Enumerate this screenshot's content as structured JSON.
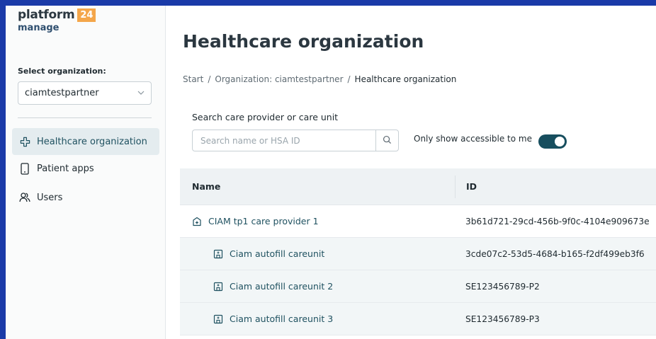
{
  "brand": {
    "name": "platform",
    "badge": "24",
    "sub": "manage"
  },
  "sidebar": {
    "org_label": "Select organization:",
    "org_value": "ciamtestpartner",
    "items": [
      {
        "label": "Healthcare organization",
        "icon": "plus-outline-icon",
        "active": true
      },
      {
        "label": "Patient apps",
        "icon": "phone-icon",
        "active": false
      },
      {
        "label": "Users",
        "icon": "users-icon",
        "active": false
      }
    ]
  },
  "main": {
    "title": "Healthcare organization",
    "breadcrumb": [
      "Start",
      "/",
      "Organization: ciamtestpartner",
      "/",
      "Healthcare organization"
    ],
    "search": {
      "label": "Search care provider or care unit",
      "placeholder": "Search name or HSA ID"
    },
    "toggle": {
      "label": "Only show accessible to me",
      "on": true
    },
    "table": {
      "columns": [
        "Name",
        "ID"
      ],
      "rows": [
        {
          "name": "CIAM tp1 care provider 1",
          "id": "3b61d721-29cd-456b-9f0c-4104e909673e",
          "icon": "care-provider-icon"
        },
        {
          "name": "Ciam autofill careunit",
          "id": "3cde07c2-53d5-4684-b165-f2df499eb3f6",
          "icon": "care-unit-icon"
        },
        {
          "name": "Ciam autofill careunit 2",
          "id": "SE123456789-P2",
          "icon": "care-unit-icon"
        },
        {
          "name": "Ciam autofill careunit 3",
          "id": "SE123456789-P3",
          "icon": "care-unit-icon"
        }
      ]
    }
  },
  "colors": {
    "accent": "#174e5e",
    "badge": "#f4a64a",
    "active_bg": "#e4ecef",
    "border": "#1a3aa8"
  }
}
